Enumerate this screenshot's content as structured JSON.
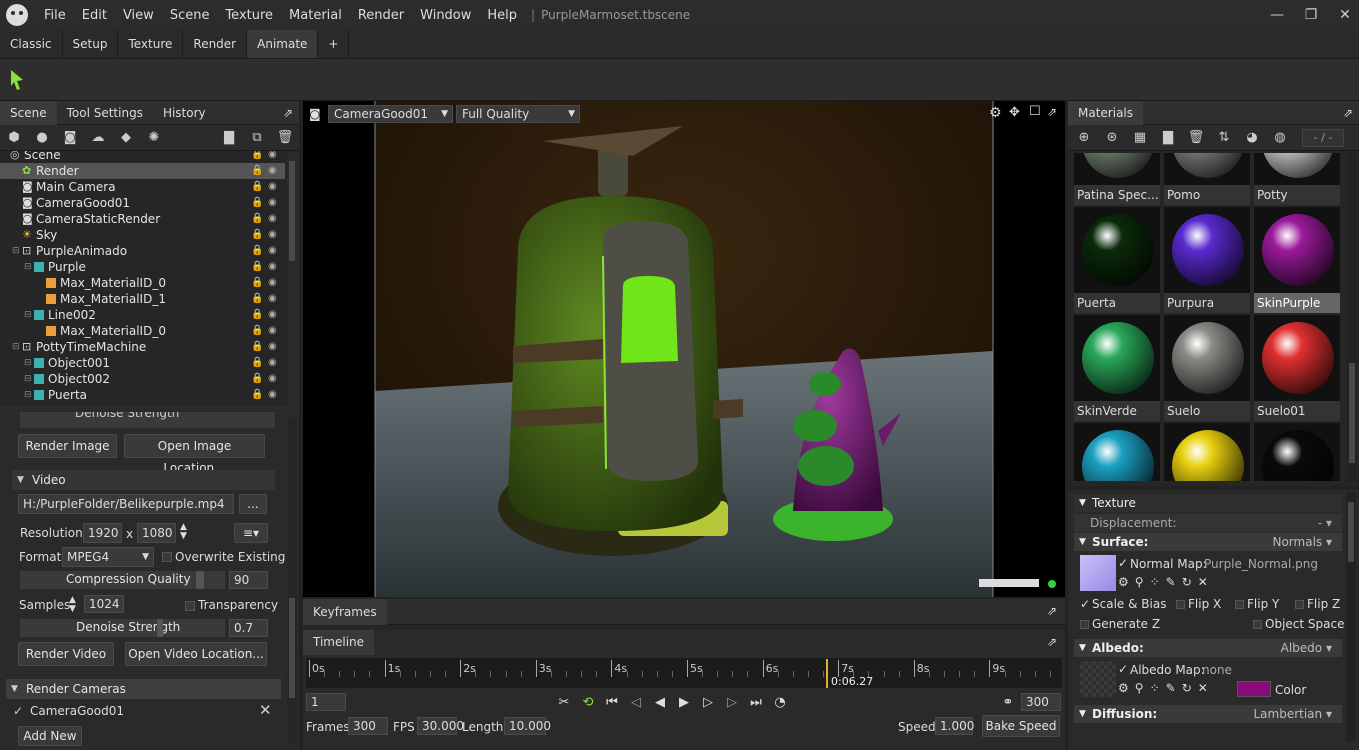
{
  "window": {
    "menu": [
      "File",
      "Edit",
      "View",
      "Scene",
      "Texture",
      "Material",
      "Render",
      "Window",
      "Help"
    ],
    "filename": "PurpleMarmoset.tbscene"
  },
  "tabs": [
    "Classic",
    "Setup",
    "Texture",
    "Render",
    "Animate",
    "+"
  ],
  "active_tab": "Animate",
  "left_panel": {
    "tabs": [
      "Scene",
      "Tool Settings",
      "History"
    ],
    "tree": [
      {
        "label": "Scene",
        "indent": 0,
        "icon": "scene"
      },
      {
        "label": "Render",
        "indent": 1,
        "icon": "render",
        "selected": true
      },
      {
        "label": "Main Camera",
        "indent": 1,
        "icon": "camera"
      },
      {
        "label": "CameraGood01",
        "indent": 1,
        "icon": "camera"
      },
      {
        "label": "CameraStaticRender",
        "indent": 1,
        "icon": "camera"
      },
      {
        "label": "Sky",
        "indent": 1,
        "icon": "sky"
      },
      {
        "label": "PurpleAnimado",
        "indent": 1,
        "icon": "group"
      },
      {
        "label": "Purple",
        "indent": 2,
        "icon": "mesh"
      },
      {
        "label": "Max_MaterialID_0",
        "indent": 3,
        "icon": "submesh"
      },
      {
        "label": "Max_MaterialID_1",
        "indent": 3,
        "icon": "submesh"
      },
      {
        "label": "Line002",
        "indent": 2,
        "icon": "mesh"
      },
      {
        "label": "Max_MaterialID_0",
        "indent": 3,
        "icon": "submesh"
      },
      {
        "label": "PottyTimeMachine",
        "indent": 1,
        "icon": "group"
      },
      {
        "label": "Object001",
        "indent": 2,
        "icon": "mesh"
      },
      {
        "label": "Object002",
        "indent": 2,
        "icon": "mesh"
      },
      {
        "label": "Puerta",
        "indent": 2,
        "icon": "mesh"
      }
    ]
  },
  "render_settings": {
    "denoise_strength_label": "Denoise Strength",
    "render_image": "Render Image",
    "open_image_location": "Open Image Location...",
    "video_section": "Video",
    "video_path": "H:/PurpleFolder/Belikepurple.mp4",
    "browse": "...",
    "resolution_label": "Resolution:",
    "res_w": "1920",
    "res_x": "x",
    "res_h": "1080",
    "format_label": "Format",
    "format_value": "MPEG4",
    "overwrite_existing": "Overwrite Existing",
    "compression_quality": "Compression Quality",
    "compression_value": "90",
    "samples_label": "Samples",
    "samples_value": "1024",
    "transparency": "Transparency",
    "denoise_value": "0.7",
    "render_video": "Render Video",
    "open_video_location": "Open Video Location...",
    "render_cameras": "Render Cameras",
    "camera_entry": "CameraGood01",
    "add_new": "Add New"
  },
  "viewport": {
    "camera": "CameraGood01",
    "quality": "Full Quality"
  },
  "keyframes_tab": "Keyframes",
  "timeline": {
    "tab": "Timeline",
    "ticks": [
      "0s",
      "1s",
      "2s",
      "3s",
      "4s",
      "5s",
      "6s",
      "7s",
      "8s",
      "9s"
    ],
    "current_time": "0:06.27",
    "current_frame": "1",
    "end_frame": "300",
    "frames_label": "Frames",
    "frames_value": "300",
    "fps_label": "FPS",
    "fps_value": "30.000",
    "length_label": "Length",
    "length_value": "10.000",
    "speed_label": "Speed",
    "speed_value": "1.000",
    "bake_speed": "Bake Speed"
  },
  "materials_panel": {
    "title": "Materials",
    "counter": "- / -",
    "materials": [
      {
        "name": "Patina Spec...",
        "color": "#7a8a7a"
      },
      {
        "name": "Pomo",
        "color": "#8a8a8a"
      },
      {
        "name": "Potty",
        "color": "#dcdcdc"
      },
      {
        "name": "Puerta",
        "color": "#0a2a0a"
      },
      {
        "name": "Purpura",
        "color": "#5a2ad0"
      },
      {
        "name": "SkinPurple",
        "color": "#9a1a9a",
        "selected": true
      },
      {
        "name": "SkinVerde",
        "color": "#2aa85a"
      },
      {
        "name": "Suelo",
        "color": "#8a8a86"
      },
      {
        "name": "Suelo01",
        "color": "#e03030"
      },
      {
        "name": "",
        "color": "#1aa0c0"
      },
      {
        "name": "",
        "color": "#e8d010"
      },
      {
        "name": "",
        "color": "#0a0a0a"
      }
    ]
  },
  "material_props": {
    "texture": "Texture",
    "displacement_label": "Displacement:",
    "displacement_value": "-",
    "surface_label": "Surface:",
    "surface_value": "Normals",
    "normal_map_label": "Normal Map:",
    "normal_map_value": "Purple_Normal.png",
    "scale_bias": "Scale & Bias",
    "flip_x": "Flip X",
    "flip_y": "Flip Y",
    "flip_z": "Flip Z",
    "generate_z": "Generate Z",
    "object_space": "Object Space",
    "albedo_label": "Albedo:",
    "albedo_value": "Albedo",
    "albedo_map_label": "Albedo Map:",
    "albedo_map_value": "none",
    "color_label": "Color",
    "albedo_color": "#8a0a7a",
    "diffusion_label": "Diffusion:",
    "diffusion_value": "Lambertian"
  }
}
